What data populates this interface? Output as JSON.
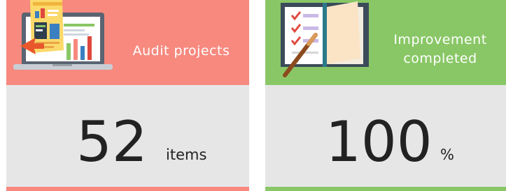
{
  "colors": {
    "audit_accent": "#f7897f",
    "improvement_accent": "#89c766",
    "panel_gray": "#e6e6e6"
  },
  "cards": [
    {
      "header_label": "Audit projects",
      "value": "52",
      "unit": "items",
      "illustration": "laptop-with-report-charts-icon"
    },
    {
      "header_label": "Improvement completed",
      "value": "100",
      "unit": "%",
      "illustration": "open-notebook-checklist-pen-icon"
    }
  ]
}
